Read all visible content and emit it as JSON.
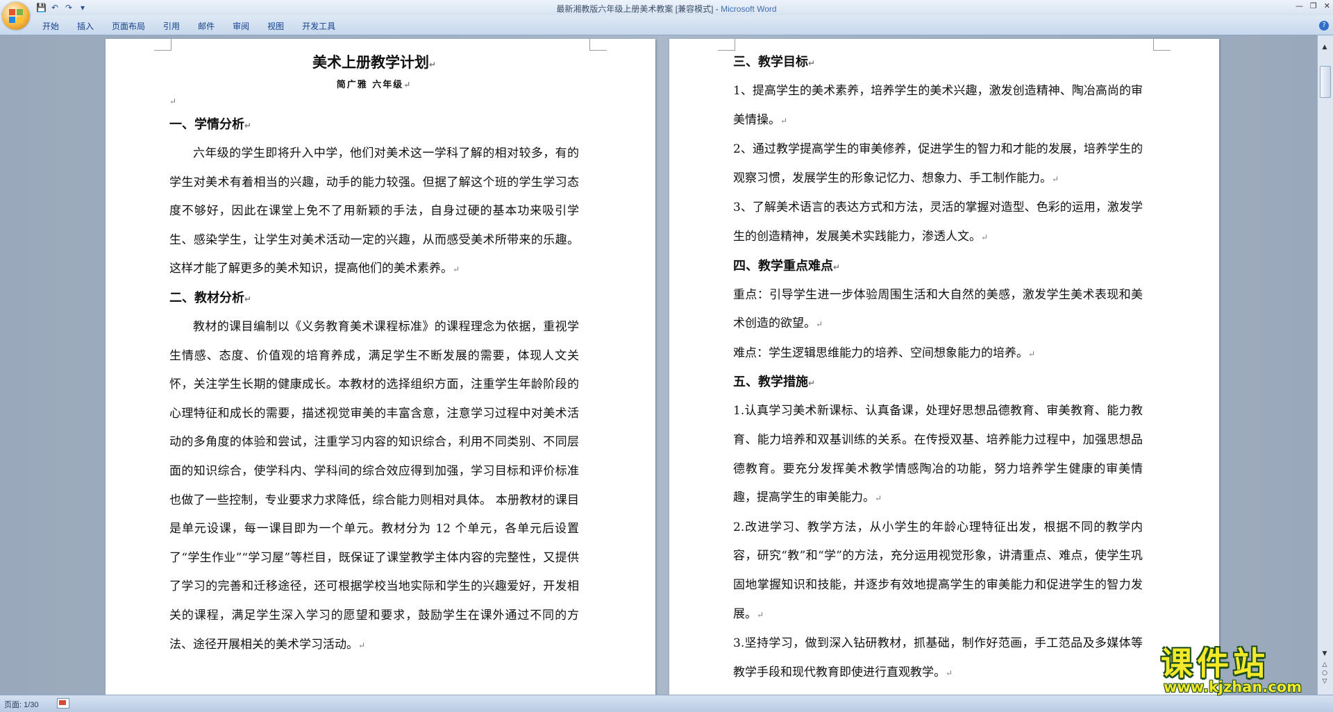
{
  "window": {
    "title": "最新湘教版六年级上册美术教案 [兼容模式]",
    "app_name": "Microsoft Word",
    "controls": [
      "—",
      "❐",
      "✕"
    ]
  },
  "quick_access": [
    "save-icon",
    "undo-icon",
    "redo-icon",
    "customize-icon"
  ],
  "ribbon": {
    "tabs": [
      "开始",
      "插入",
      "页面布局",
      "引用",
      "邮件",
      "审阅",
      "视图",
      "开发工具"
    ]
  },
  "page1": {
    "title": "美术上册教学计划",
    "subtitle": "简广雅    六年级",
    "sections": [
      {
        "heading": "一、学情分析",
        "paragraphs": [
          "六年级的学生即将升入中学，他们对美术这一学科了解的相对较多，有的学生对美术有着相当的兴趣，动手的能力较强。但据了解这个班的学生学习态度不够好，因此在课堂上免不了用新颖的手法，自身过硬的基本功来吸引学生、感染学生，让学生对美术活动一定的兴趣，从而感受美术所带来的乐趣。这样才能了解更多的美术知识，提高他们的美术素养。"
        ]
      },
      {
        "heading": "二、教材分析",
        "paragraphs": [
          "教材的课目编制以《义务教育美术课程标准》的课程理念为依据，重视学生情感、态度、价值观的培育养成，满足学生不断发展的需要，体现人文关怀，关注学生长期的健康成长。本教材的选择组织方面，注重学生年龄阶段的心理特征和成长的需要，描述视觉审美的丰富含意，注意学习过程中对美术活动的多角度的体验和尝试，注重学习内容的知识综合，利用不同类别、不同层面的知识综合，使学科内、学科间的综合效应得到加强，学习目标和评价标准也做了一些控制，专业要求力求降低，综合能力则相对具体。    本册教材的课目是单元设课，每一课目即为一个单元。教材分为 12 个单元，各单元后设置了“学生作业”“学习屋”等栏目，既保证了课堂教学主体内容的完整性，又提供了学习的完善和迁移途径，还可根据学校当地实际和学生的兴趣爱好，开发相关的课程，满足学生深入学习的愿望和要求，鼓励学生在课外通过不同的方法、途径开展相关的美术学习活动。"
        ]
      }
    ]
  },
  "page2": {
    "sections": [
      {
        "heading": "三、教学目标",
        "paragraphs": [
          "1、提高学生的美术素养，培养学生的美术兴趣，激发创造精神、陶冶高尚的审美情操。",
          "2、通过教学提高学生的审美修养，促进学生的智力和才能的发展，培养学生的观察习惯，发展学生的形象记忆力、想象力、手工制作能力。",
          "3、了解美术语言的表达方式和方法，灵活的掌握对造型、色彩的运用，激发学生的创造精神，发展美术实践能力，渗透人文。"
        ]
      },
      {
        "heading": "四、教学重点难点",
        "paragraphs": [
          "重点：引导学生进一步体验周围生活和大自然的美感，激发学生美术表现和美术创造的欲望。",
          "难点：学生逻辑思维能力的培养、空间想象能力的培养。"
        ]
      },
      {
        "heading": "五、教学措施",
        "paragraphs": [
          "1.认真学习美术新课标、认真备课，处理好思想品德教育、审美教育、能力教育、能力培养和双基训练的关系。在传授双基、培养能力过程中，加强思想品德教育。要充分发挥美术教学情感陶冶的功能，努力培养学生健康的审美情趣，提高学生的审美能力。",
          "2.改进学习、教学方法，从小学生的年龄心理特征出发，根据不同的教学内容，研究“教”和“学”的方法，充分运用视觉形象，讲清重点、难点，使学生巩固地掌握知识和技能，并逐步有效地提高学生的审美能力和促进学生的智力发展。",
          "3.坚持学习，做到深入钻研教材，抓基础，制作好范画，手工范品及多媒体等教学手段和现代教育即使进行直观教学。"
        ]
      }
    ]
  },
  "paragraph_mark": "↵",
  "status": {
    "page": "页面: 1/30"
  },
  "watermark": {
    "title": "课件站",
    "url": "www.kjzhan.com"
  },
  "colors": {
    "ribbon_text": "#15428b",
    "app_name": "#3d6fb0",
    "watermark_fill": "#f3e92a",
    "watermark_outline": "#1c4c1a"
  }
}
